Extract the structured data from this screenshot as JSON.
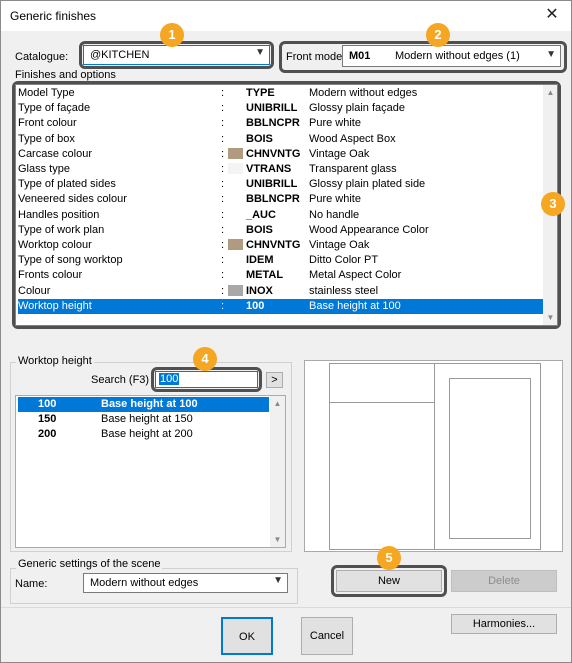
{
  "window": {
    "title": "Generic finishes",
    "close_glyph": "✕"
  },
  "catalogue": {
    "label": "Catalogue:",
    "value": "@KITCHEN"
  },
  "front_model": {
    "label": "Front model:",
    "code": "M01",
    "name": "Modern without edges (1)"
  },
  "finishes": {
    "header": "Finishes and options",
    "separator": ":",
    "rows": [
      {
        "name": "Model Type",
        "code": "TYPE",
        "desc": "Modern without edges",
        "swatch": ""
      },
      {
        "name": "Type of façade",
        "code": "UNIBRILL",
        "desc": "Glossy plain façade",
        "swatch": ""
      },
      {
        "name": "Front colour",
        "code": "BBLNCPR",
        "desc": "Pure white",
        "swatch": ""
      },
      {
        "name": "Type of box",
        "code": "BOIS",
        "desc": "Wood Aspect Box",
        "swatch": ""
      },
      {
        "name": "Carcase colour",
        "code": "CHNVNTG",
        "desc": "Vintage Oak",
        "swatch": "#b09a80"
      },
      {
        "name": "Glass type",
        "code": "VTRANS",
        "desc": "Transparent glass",
        "swatch": "#f4f4f4"
      },
      {
        "name": "Type of plated sides",
        "code": "UNIBRILL",
        "desc": "Glossy plain plated side",
        "swatch": ""
      },
      {
        "name": "Veneered sides colour",
        "code": "BBLNCPR",
        "desc": "Pure white",
        "swatch": ""
      },
      {
        "name": "Handles position",
        "code": "_AUC",
        "desc": "No handle",
        "swatch": ""
      },
      {
        "name": "Type of work plan",
        "code": "BOIS",
        "desc": "Wood Appearance Color",
        "swatch": ""
      },
      {
        "name": "Worktop colour",
        "code": "CHNVNTG",
        "desc": "Vintage Oak",
        "swatch": "#b09a80"
      },
      {
        "name": "Type of song worktop",
        "code": "IDEM",
        "desc": "Ditto Color PT",
        "swatch": ""
      },
      {
        "name": "Fronts colour",
        "code": "METAL",
        "desc": "Metal Aspect Color",
        "swatch": ""
      },
      {
        "name": "Colour",
        "code": "INOX",
        "desc": "stainless steel",
        "swatch": "#a8a8a8"
      },
      {
        "name": "Worktop height",
        "code": "100",
        "desc": "Base height at 100",
        "swatch": ""
      }
    ]
  },
  "worktop": {
    "group_label": "Worktop height",
    "search_label": "Search (F3)",
    "search_value": "100",
    "go_label": ">",
    "items": [
      {
        "code": "100",
        "desc": "Base height at 100"
      },
      {
        "code": "150",
        "desc": "Base height at 150"
      },
      {
        "code": "200",
        "desc": "Base height at 200"
      }
    ]
  },
  "scene": {
    "group_label": "Generic settings of the scene",
    "name_label": "Name:",
    "name_value": "Modern without edges"
  },
  "buttons": {
    "new": "New",
    "delete": "Delete",
    "ok": "OK",
    "cancel": "Cancel",
    "harmonies": "Harmonies..."
  },
  "badges": [
    "1",
    "2",
    "3",
    "4",
    "5"
  ],
  "colors": {
    "badge": "#f5a623",
    "selection": "#0078d7",
    "highlight_border": "#505050"
  }
}
